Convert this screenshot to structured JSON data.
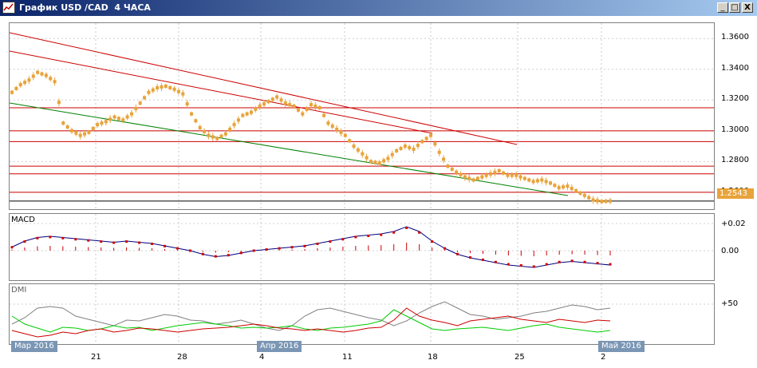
{
  "window": {
    "title": "График USD /CAD  4 ЧАСА",
    "minimize_glyph": "_",
    "restore_glyph": "□",
    "close_glyph": "X"
  },
  "price_axis": [
    "1.3600",
    "1.3400",
    "1.3200",
    "1.3000",
    "1.2800",
    "1.2600"
  ],
  "current_price": "1.2543",
  "macd": {
    "label": "MACD",
    "axis": [
      "+0.02",
      "0.00"
    ]
  },
  "dmi": {
    "label": "DMI",
    "axis": [
      "+50"
    ]
  },
  "dates": [
    "21",
    "28",
    "4",
    "11",
    "18",
    "25",
    "2"
  ],
  "months": [
    "Мар 2016",
    "Апр 2016",
    "Май 2016"
  ],
  "colors": {
    "candles": "#e8a33a",
    "levels": "#cc0000",
    "trendline_green": "#008000",
    "macd_signal": "#cc0000",
    "dmi_plus": "#00cc00",
    "dmi_minus": "#cc0000",
    "adx": "#808080"
  },
  "chart_data": {
    "type": "line",
    "title": "График USD /CAD  4 ЧАСА",
    "ylim": [
      1.248,
      1.37
    ],
    "y_ticks": [
      1.36,
      1.34,
      1.32,
      1.3,
      1.28,
      1.26
    ],
    "horizontal_levels": [
      1.315,
      1.3,
      1.293,
      1.277,
      1.272,
      1.26
    ],
    "last_price": 1.2543,
    "close_series": [
      1.325,
      1.33,
      1.333,
      1.338,
      1.336,
      1.332,
      1.305,
      1.3,
      1.297,
      1.299,
      1.304,
      1.306,
      1.309,
      1.307,
      1.311,
      1.318,
      1.325,
      1.328,
      1.329,
      1.327,
      1.324,
      1.311,
      1.302,
      1.297,
      1.295,
      1.298,
      1.304,
      1.31,
      1.312,
      1.316,
      1.319,
      1.322,
      1.318,
      1.316,
      1.311,
      1.317,
      1.315,
      1.305,
      1.301,
      1.297,
      1.29,
      1.285,
      1.28,
      1.279,
      1.282,
      1.287,
      1.29,
      1.288,
      1.293,
      1.297,
      1.286,
      1.277,
      1.273,
      1.27,
      1.268,
      1.27,
      1.272,
      1.274,
      1.271,
      1.271,
      1.269,
      1.267,
      1.268,
      1.266,
      1.263,
      1.264,
      1.261,
      1.258,
      1.255,
      1.254,
      1.2543
    ]
  }
}
